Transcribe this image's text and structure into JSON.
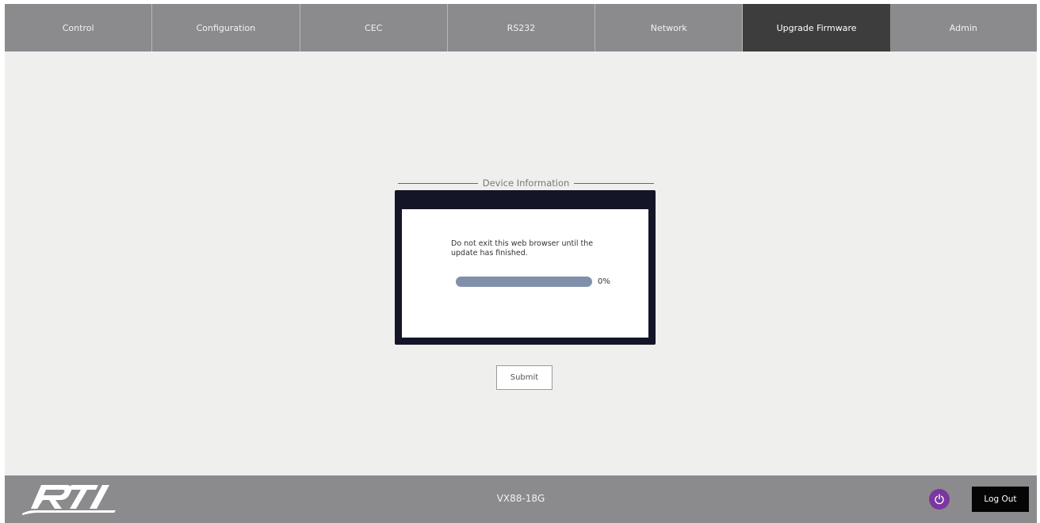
{
  "nav": {
    "tabs": [
      {
        "label": "Control",
        "active": false
      },
      {
        "label": "Configuration",
        "active": false
      },
      {
        "label": "CEC",
        "active": false
      },
      {
        "label": "RS232",
        "active": false
      },
      {
        "label": "Network",
        "active": false
      },
      {
        "label": "Upgrade Firmware",
        "active": true
      },
      {
        "label": "Admin",
        "active": false
      }
    ]
  },
  "dialog": {
    "legend": "Device Information",
    "message": "Do not exit this web browser until the update has finished.",
    "progress": {
      "value": 0,
      "label": "0%"
    }
  },
  "form": {
    "submit_label": "Submit"
  },
  "footer": {
    "logo": "RTI",
    "model": "VX88-18G",
    "power_icon": "power-icon",
    "logout_label": "Log Out"
  },
  "colors": {
    "nav_bg": "#8b8b8e",
    "nav_active": "#3d3d3d",
    "page_bg": "#eff0ee",
    "dialog_frame": "#141628",
    "progress_track": "#8090aa",
    "power_button": "#7b37a0",
    "logout_button": "#050505"
  }
}
